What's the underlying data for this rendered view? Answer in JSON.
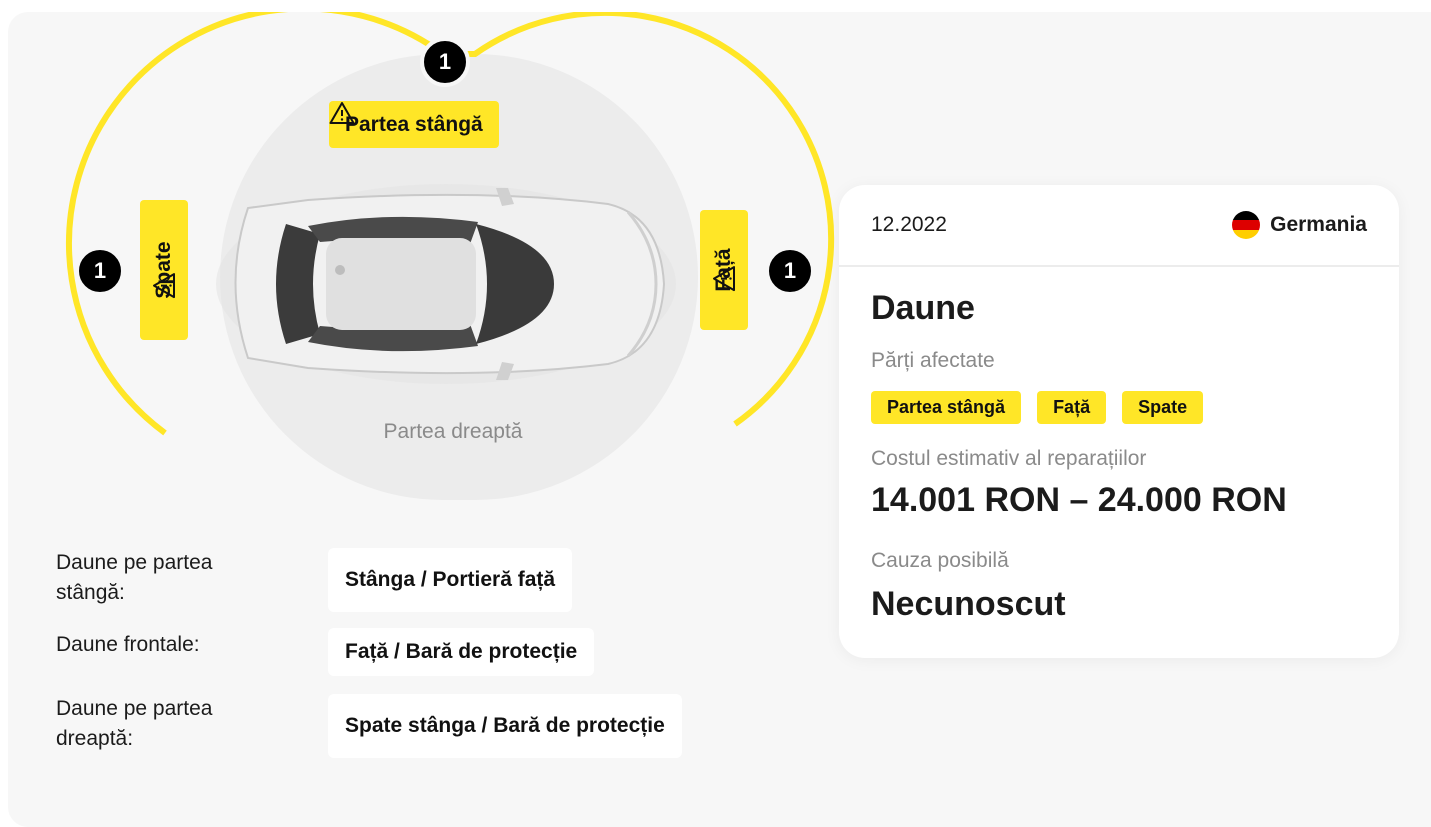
{
  "diagram": {
    "top_marker": "1",
    "left_marker": "1",
    "right_marker": "1",
    "top_tag": "Partea stângă",
    "left_tag": "Spate",
    "right_tag": "Față",
    "bottom_label": "Partea dreaptă",
    "accent_color": "#FFE627",
    "warning_icon": "warning-triangle-icon"
  },
  "details": [
    {
      "label": "Daune pe partea stângă:",
      "value": "Stânga / Portieră față"
    },
    {
      "label": "Daune frontale:",
      "value": "Față / Bară de protecție"
    },
    {
      "label": "Daune pe partea dreaptă:",
      "value": "Spate stânga / Bară de protecție"
    }
  ],
  "card": {
    "date": "12.2022",
    "country": "Germania",
    "title": "Daune",
    "affected_label": "Părți afectate",
    "affected_parts": [
      "Partea stângă",
      "Față",
      "Spate"
    ],
    "cost_label": "Costul estimativ al reparațiilor",
    "cost_value": "14.001 RON – 24.000 RON",
    "cause_label": "Cauza posibilă",
    "cause_value": "Necunoscut"
  }
}
